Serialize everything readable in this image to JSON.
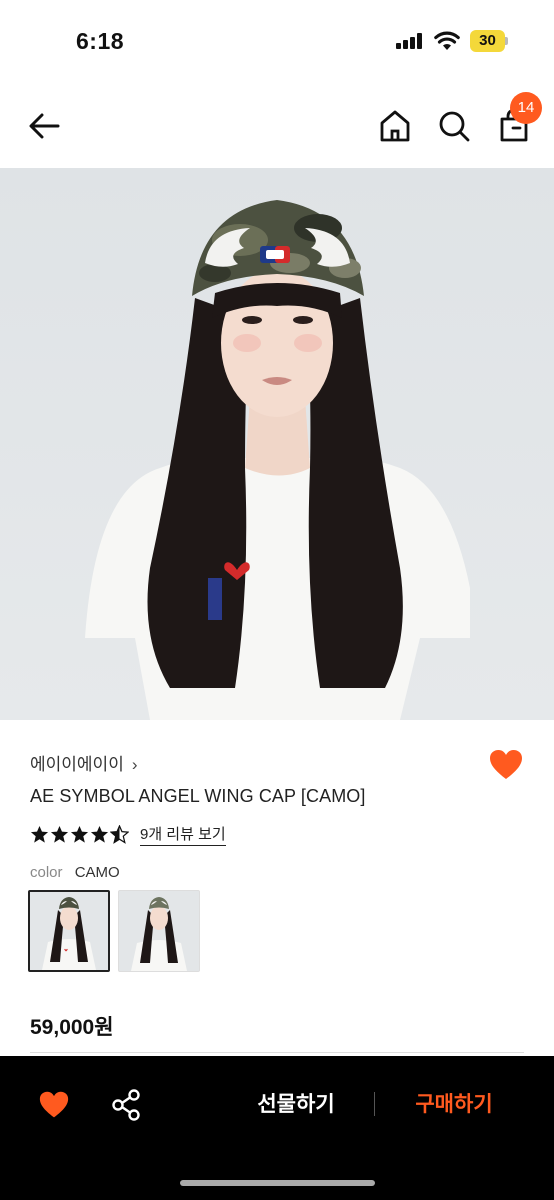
{
  "status_bar": {
    "time": "6:18",
    "battery": "30"
  },
  "nav": {
    "cart_count": "14",
    "icons": [
      "back-arrow-icon",
      "home-icon",
      "search-icon",
      "shopping-bag-icon"
    ]
  },
  "product": {
    "brand": "에이이에이이",
    "brand_chevron": "›",
    "title": "AE SYMBOL ANGEL WING CAP [CAMO]",
    "rating": 4.5,
    "review_link": "9개 리뷰 보기",
    "color_label": "color",
    "color_value": "CAMO",
    "price": "59,000원",
    "liked": true
  },
  "bottom_bar": {
    "gift_label": "선물하기",
    "buy_label": "구매하기"
  },
  "colors": {
    "accent": "#ff5a1f",
    "bottom_bar_bg": "#000000",
    "battery": "#f4d83a"
  }
}
